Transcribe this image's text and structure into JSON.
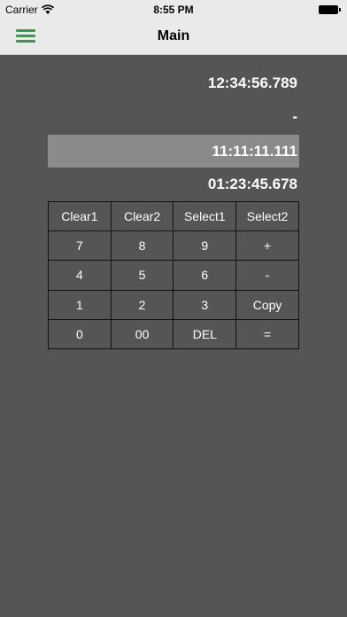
{
  "status_bar": {
    "carrier": "Carrier",
    "time": "8:55 PM"
  },
  "nav": {
    "title": "Main",
    "menu_icon": "hamburger-menu-icon",
    "accent_color": "#2aa43a"
  },
  "displays": {
    "value1": "12:34:56.789",
    "operator": "-",
    "value2": "11:11:11.111",
    "result": "01:23:45.678"
  },
  "keypad": {
    "rows": [
      [
        "Clear1",
        "Clear2",
        "Select1",
        "Select2"
      ],
      [
        "7",
        "8",
        "9",
        "+"
      ],
      [
        "4",
        "5",
        "6",
        "-"
      ],
      [
        "1",
        "2",
        "3",
        "Copy"
      ],
      [
        "0",
        "00",
        "DEL",
        "="
      ]
    ]
  },
  "colors": {
    "background": "#555555",
    "selected_row": "#8a8a8a"
  }
}
